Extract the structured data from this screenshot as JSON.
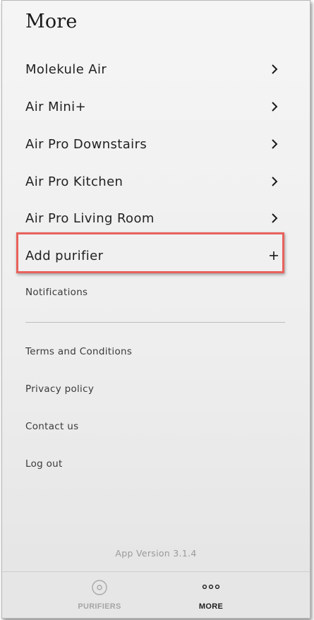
{
  "header": {
    "title": "More"
  },
  "purifiers": [
    {
      "label": "Molekule Air"
    },
    {
      "label": "Air Mini+"
    },
    {
      "label": "Air Pro Downstairs"
    },
    {
      "label": "Air Pro Kitchen"
    },
    {
      "label": "Air Pro Living Room"
    }
  ],
  "add_purifier": {
    "label": "Add purifier",
    "icon": "plus-icon"
  },
  "highlight_color": "#e8625c",
  "links": {
    "notifications": "Notifications",
    "terms": "Terms and Conditions",
    "privacy": "Privacy policy",
    "contact": "Contact us",
    "logout": "Log out"
  },
  "app_version": "App Version 3.1.4",
  "tabbar": {
    "purifiers": {
      "label": "PURIFIERS",
      "icon": "purifier-icon",
      "active": false
    },
    "more": {
      "label": "MORE",
      "icon": "more-dots-icon",
      "active": true
    }
  }
}
